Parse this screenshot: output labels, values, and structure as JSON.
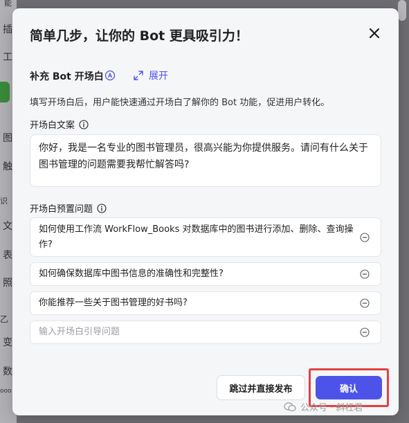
{
  "background": {
    "sidebar_items": [
      "插",
      "工",
      "图",
      "触",
      "识",
      "文",
      "表",
      "照",
      "乙",
      "变",
      "数",
      "ooo"
    ],
    "top_partial": "能"
  },
  "modal": {
    "title": "简单几步，让你的 Bot 更具吸引力！",
    "close_icon": "close-icon",
    "section": {
      "title": "补充 Bot 开场白",
      "badge_icon": "auto-badge-icon",
      "expand_label": "展开",
      "expand_icon": "expand-arrows-icon",
      "description": "填写开场白后，用户能快速通过开场白了解你的 Bot 功能，促进用户转化。"
    },
    "opening_text": {
      "label": "开场白文案",
      "value": "你好，我是一名专业的图书管理员，很高兴能为你提供服务。请问有什么关于图书管理的问题需要我帮忙解答吗?"
    },
    "preset_questions": {
      "label": "开场白预置问题",
      "items": [
        "如何使用工作流 WorkFlow_Books 对数据库中的图书进行添加、删除、查询操作?",
        "如何确保数据库中图书信息的准确性和完整性?",
        "你能推荐一些关于图书管理的好书吗?"
      ],
      "input_placeholder": "输入开场白引导问题"
    },
    "buttons": {
      "skip": "跳过并直接发布",
      "confirm": "确认"
    },
    "colors": {
      "accent": "#4d53e8",
      "highlight": "#e44040"
    }
  },
  "watermark": "公众号 · 斜杠君"
}
